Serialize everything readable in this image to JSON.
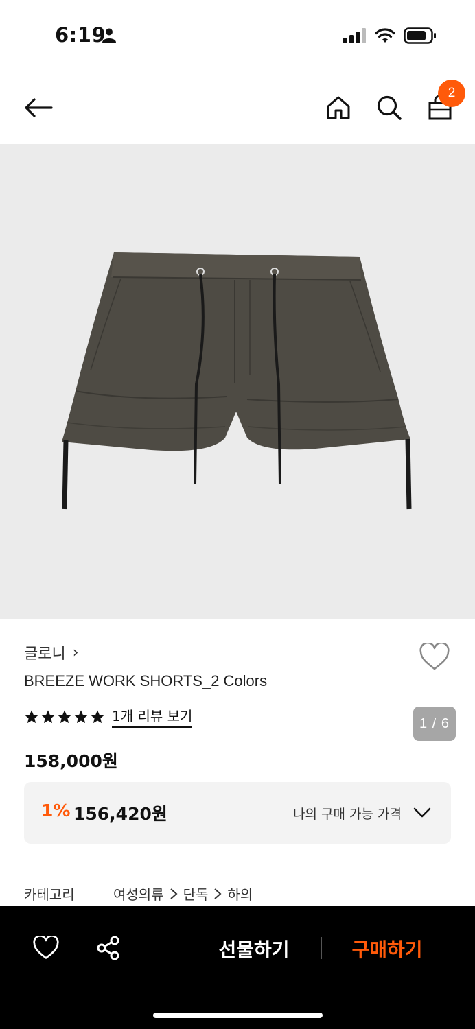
{
  "status_bar": {
    "time": "6:19"
  },
  "nav": {
    "cart_badge_count": "2",
    "icons": [
      "back-arrow-icon",
      "home-icon",
      "search-icon",
      "shopping-bag-icon"
    ]
  },
  "gallery": {
    "counter": "1 / 6"
  },
  "product": {
    "brand": "글로니",
    "brand_chevron": "›",
    "name": "BREEZE WORK SHORTS_2 Colors",
    "rating_stars": 5,
    "review_link": "1개 리뷰 보기",
    "price": "158,000원",
    "discount": {
      "rate": "1%",
      "price": "156,420원",
      "label": "나의 구매 가능 가격"
    },
    "category": {
      "label": "카테고리",
      "path": [
        "여성의류",
        "단독",
        "하의"
      ]
    }
  },
  "bottom_bar": {
    "gift_label": "선물하기",
    "buy_label": "구매하기"
  },
  "colors": {
    "accent": "#ff5a0a",
    "hero_bg": "#ebebeb",
    "discount_bg": "#f3f3f3",
    "bottom_bar_bg": "#000000"
  }
}
